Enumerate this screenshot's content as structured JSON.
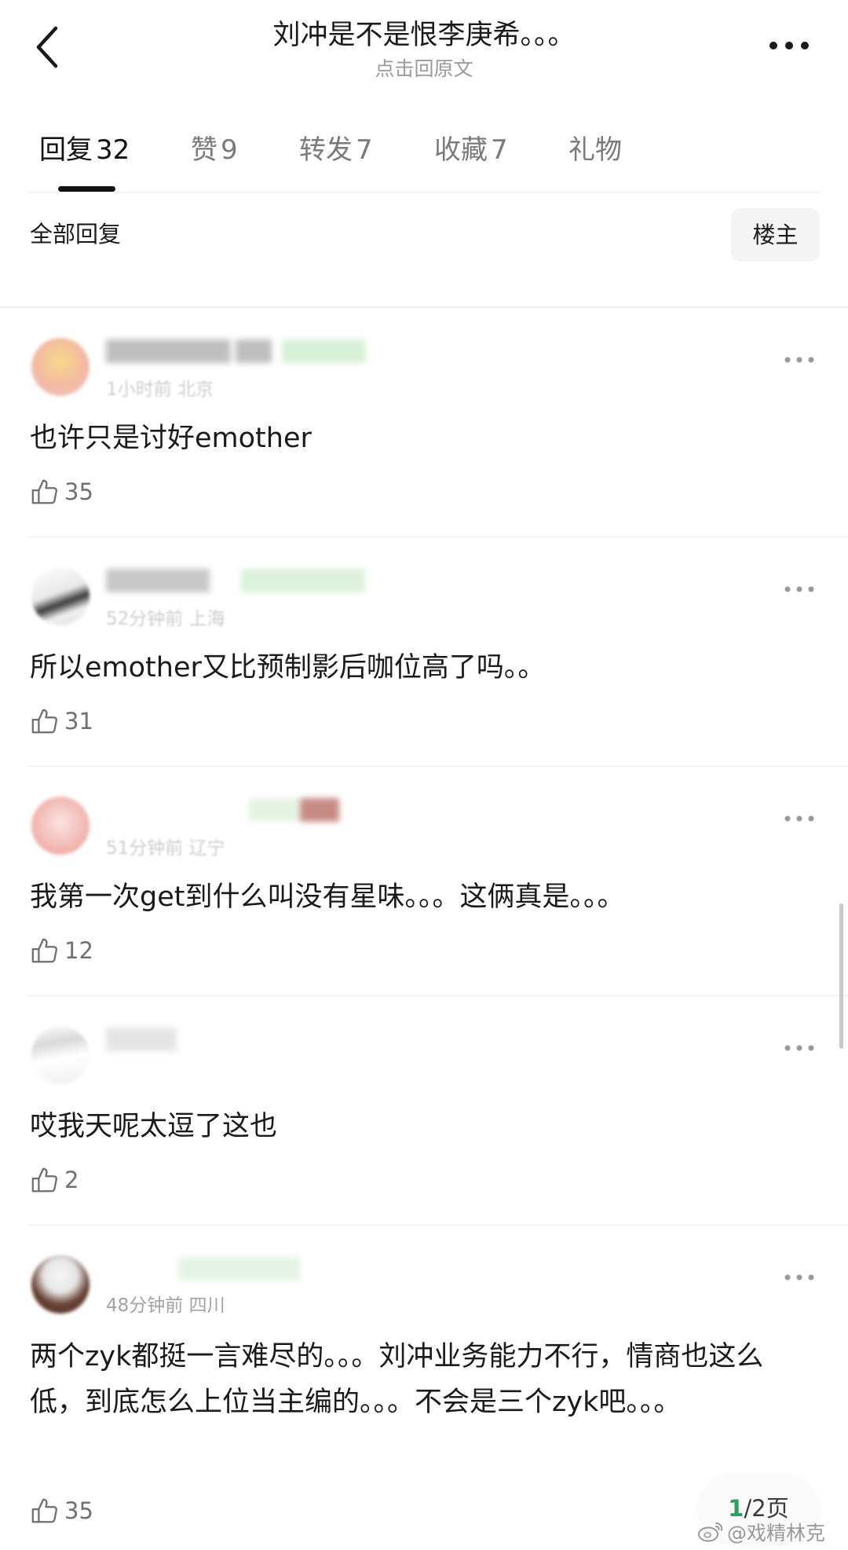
{
  "header": {
    "title": "刘冲是不是恨李庚希。。。",
    "subtitle": "点击回原文"
  },
  "tabs": [
    {
      "label": "回复",
      "count": "32",
      "active": true
    },
    {
      "label": "赞",
      "count": "9",
      "active": false
    },
    {
      "label": "转发",
      "count": "7",
      "active": false
    },
    {
      "label": "收藏",
      "count": "7",
      "active": false
    },
    {
      "label": "礼物",
      "count": "",
      "active": false
    }
  ],
  "filter": {
    "label": "全部回复",
    "op_button": "楼主"
  },
  "comments": [
    {
      "meta": "1小时前 北京",
      "text": "也许只是讨好emother",
      "likes": "35"
    },
    {
      "meta": "52分钟前 上海",
      "text": "所以emother又比预制影后咖位高了吗。。",
      "likes": "31"
    },
    {
      "meta": "51分钟前 辽宁",
      "text": "我第一次get到什么叫没有星味。。。这俩真是。。。",
      "likes": "12"
    },
    {
      "meta": "",
      "text": "哎我天呢太逗了这也",
      "likes": "2"
    },
    {
      "meta": "48分钟前 四川",
      "text": "两个zyk都挺一言难尽的。。。刘冲业务能力不行，情商也这么低，到底怎么上位当主编的。。。不会是三个zyk吧。。。",
      "likes": "35"
    }
  ],
  "pager": {
    "current": "1",
    "total_text": "/2页"
  },
  "watermark": "@戏精林克",
  "colors": {
    "pager_current": "#2e9e5e",
    "meta_text": "#a3a3a3"
  },
  "icons": [
    "back-arrow-icon",
    "more-dots-icon",
    "thumbs-up-icon",
    "weibo-logo-icon"
  ]
}
